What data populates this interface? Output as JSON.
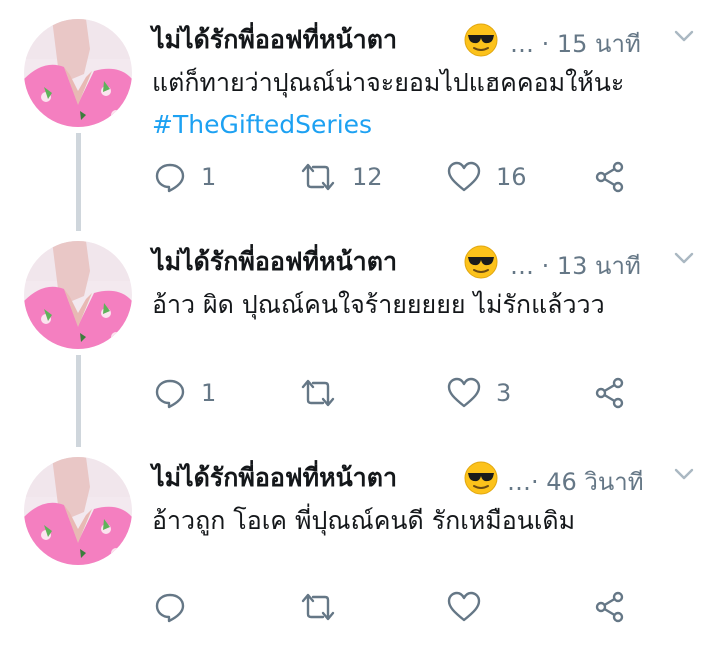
{
  "tweets": [
    {
      "author_name": "ไม่ได้รักพี่ออฟที่หน้าตา",
      "emoji": "sunglasses-emoji",
      "timestamp": "… · 15 นาที",
      "text": "แต่ก็ทายว่าปุณณ์น่าจะยอมไปแฮคคอมให้นะ ",
      "hashtag": "#TheGiftedSeries",
      "reply_count": "1",
      "retweet_count": "12",
      "like_count": "16"
    },
    {
      "author_name": "ไม่ได้รักพี่ออฟที่หน้าตา",
      "emoji": "sunglasses-emoji",
      "timestamp": "… · 13 นาที",
      "text": "อ้าว ผิด ปุณณ์คนใจร้ายยยยย ไม่รักแล้ววว",
      "hashtag": "",
      "reply_count": "1",
      "retweet_count": "",
      "like_count": "3"
    },
    {
      "author_name": "ไม่ได้รักพี่ออฟที่หน้าตา",
      "emoji": "sunglasses-emoji",
      "timestamp": "…· 46 วินาที",
      "text": "อ้าวถูก โอเค พี่ปุณณ์คนดี รักเหมือนเดิม",
      "hashtag": "",
      "reply_count": "",
      "retweet_count": "",
      "like_count": ""
    }
  ],
  "colors": {
    "hashtag": "#1da1f2",
    "meta_text": "#657786",
    "thread_line": "#cfd6dc",
    "icon": "#657786"
  }
}
